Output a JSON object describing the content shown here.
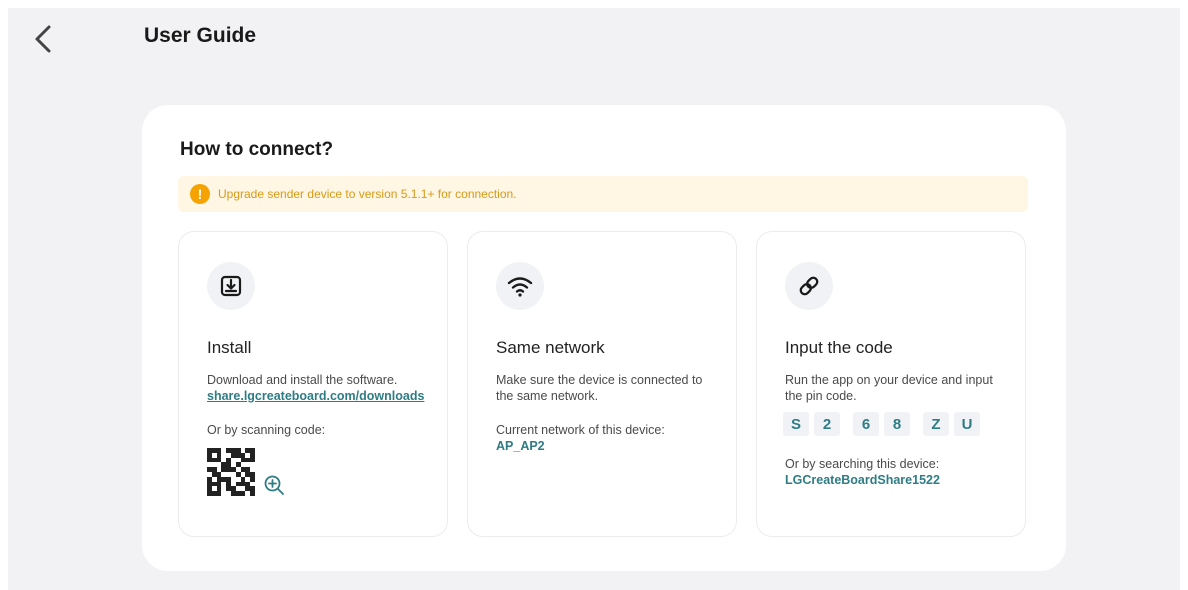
{
  "header": {
    "title": "User Guide"
  },
  "panel": {
    "title": "How to connect?",
    "notice": "Upgrade sender device to version 5.1.1+ for connection.",
    "notice_icon": "!"
  },
  "cards": {
    "install": {
      "icon": "download-icon",
      "title": "Install",
      "description": "Download and install the software.",
      "link": "share.lgcreateboard.com/downloads",
      "scan_label": "Or by scanning code:"
    },
    "network": {
      "icon": "wifi-icon",
      "title": "Same network",
      "description": "Make sure the device is connected to the same network.",
      "current_label": "Current network of this device:",
      "network_name": "AP_AP2"
    },
    "code": {
      "icon": "link-icon",
      "title": "Input the code",
      "description": "Run the app on your device and input the pin code.",
      "pin": [
        "S",
        "2",
        "6",
        "8",
        "Z",
        "U"
      ],
      "search_label": "Or by searching this device:",
      "device_name": "LGCreateBoardShare1522"
    }
  },
  "colors": {
    "accent": "#2f7c84",
    "warning": "#f4a300",
    "notice_bg": "#fff6e3"
  }
}
